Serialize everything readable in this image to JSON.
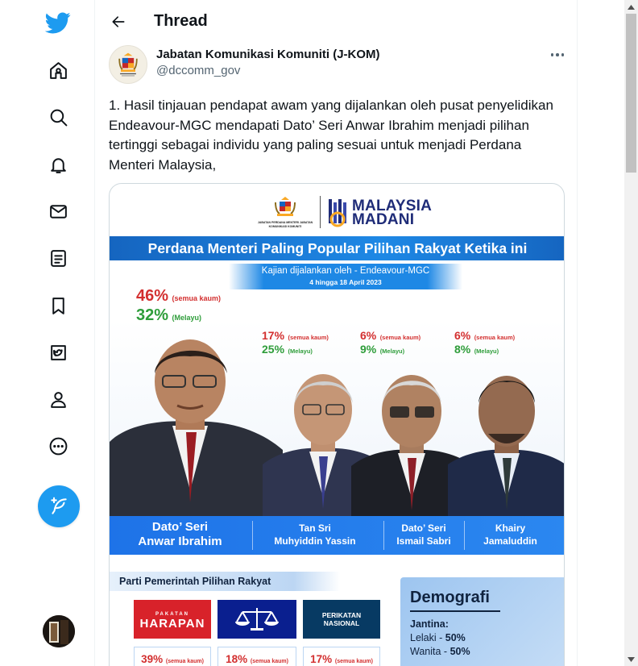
{
  "header": {
    "title": "Thread"
  },
  "nav": {
    "items": [
      {
        "icon": "home-icon"
      },
      {
        "icon": "search-icon"
      },
      {
        "icon": "bell-icon"
      },
      {
        "icon": "mail-icon"
      },
      {
        "icon": "lists-icon"
      },
      {
        "icon": "bookmark-icon"
      },
      {
        "icon": "twitter-blue-icon"
      },
      {
        "icon": "profile-icon"
      },
      {
        "icon": "more-circle-icon"
      }
    ],
    "compose_icon": "compose-feather-icon"
  },
  "tweet": {
    "author_name": "Jabatan Komunikasi Komuniti (J-KOM)",
    "author_handle": "@dccomm_gov",
    "text": "1. Hasil tinjauan pendapat awam yang dijalankan oleh pusat penyelidikan Endeavour-MGC mendapati Dato’ Seri Anwar Ibrahim menjadi pilihan tertinggi sebagai individu yang paling sesuai untuk menjadi Perdana Menteri Malaysia,"
  },
  "infographic": {
    "crest_caption": "JABATAN PERDANA MENTERI JABATAN KOMUNIKASI KOMUNITI",
    "madani_line1": "MALAYSIA",
    "madani_line2": "MADANI",
    "title": "Perdana Menteri Paling Popular Pilihan Rakyat Ketika ini",
    "subtitle": "Kajian dijalankan oleh - Endeavour-MGC",
    "date_range": "4 hingga 18 April 2023",
    "candidates": [
      {
        "name_line1": "Dato’ Seri",
        "name_line2": "Anwar Ibrahim",
        "all_pct": "46%",
        "all_label": "(semua kaum)",
        "malay_pct": "32%",
        "malay_label": "(Melayu)"
      },
      {
        "name_line1": "Tan Sri",
        "name_line2": "Muhyiddin Yassin",
        "all_pct": "17%",
        "all_label": "(semua kaum)",
        "malay_pct": "25%",
        "malay_label": "(Melayu)"
      },
      {
        "name_line1": "Dato’ Seri",
        "name_line2": "Ismail Sabri",
        "all_pct": "6%",
        "all_label": "(semua kaum)",
        "malay_pct": "9%",
        "malay_label": "(Melayu)"
      },
      {
        "name_line1": "Khairy",
        "name_line2": "Jamaluddin",
        "all_pct": "6%",
        "all_label": "(semua kaum)",
        "malay_pct": "8%",
        "malay_label": "(Melayu)"
      }
    ],
    "party_section_title": "Parti Pemerintah Pilihan Rakyat",
    "parties": [
      {
        "logo_line1": "PAKATAN",
        "logo_line2": "HARAPAN",
        "pct": "39%",
        "label": "(semua kaum)"
      },
      {
        "logo_line1": "",
        "logo_line2": "",
        "pct": "18%",
        "label": "(semua kaum)"
      },
      {
        "logo_line1": "PERIKATAN",
        "logo_line2": "NASIONAL",
        "pct": "17%",
        "label": "(semua kaum)"
      }
    ],
    "demographics": {
      "title": "Demografi",
      "gender_label": "Jantina:",
      "male_label": "Lelaki",
      "male_value": "50%",
      "female_label": "Wanita",
      "female_value": "50%"
    }
  },
  "colors": {
    "accent": "#1d9bf0",
    "banner_blue": "#1e88e5",
    "stat_red": "#d32f2f",
    "stat_green": "#2e9d3a"
  }
}
